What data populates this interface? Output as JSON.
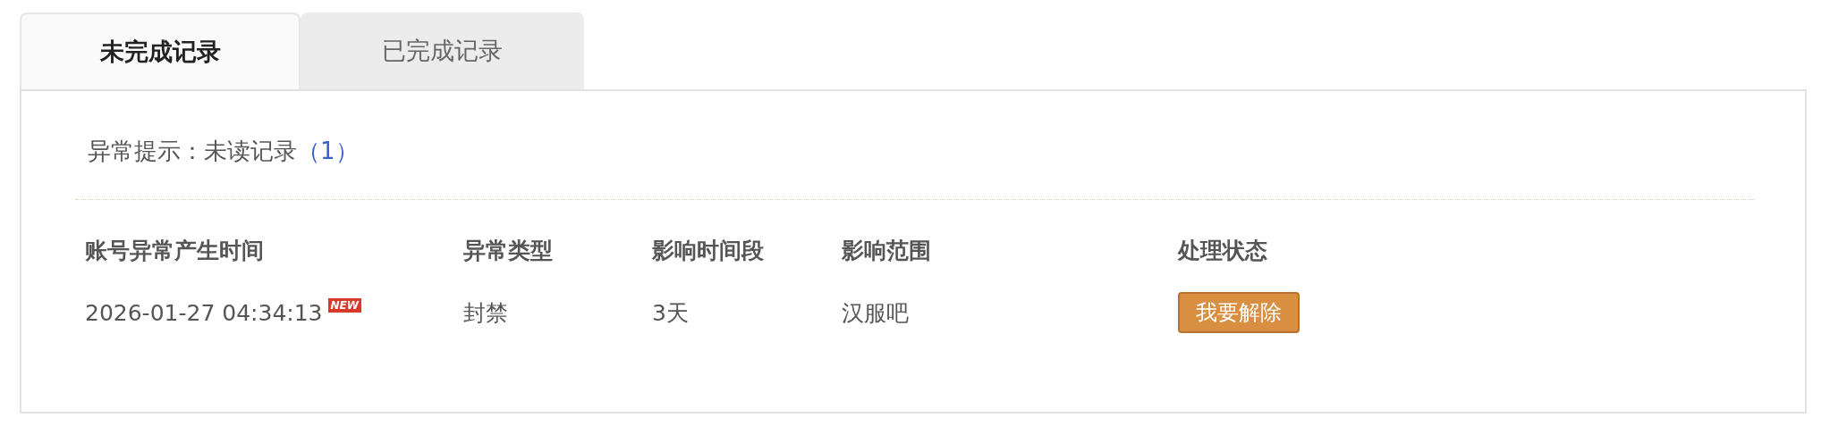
{
  "tabs": [
    {
      "label": "未完成记录",
      "selected": true
    },
    {
      "label": "已完成记录",
      "selected": false
    }
  ],
  "notice": {
    "label": "异常提示：未读记录",
    "count": "（1）"
  },
  "table": {
    "columns": [
      "账号异常产生时间",
      "异常类型",
      "影响时间段",
      "影响范围",
      "处理状态"
    ],
    "rows": [
      {
        "time": "2026-01-27 04:34:13",
        "badge": "NEW",
        "type": "封禁",
        "period": "3天",
        "scope": "汉服吧",
        "action": "我要解除"
      }
    ]
  }
}
